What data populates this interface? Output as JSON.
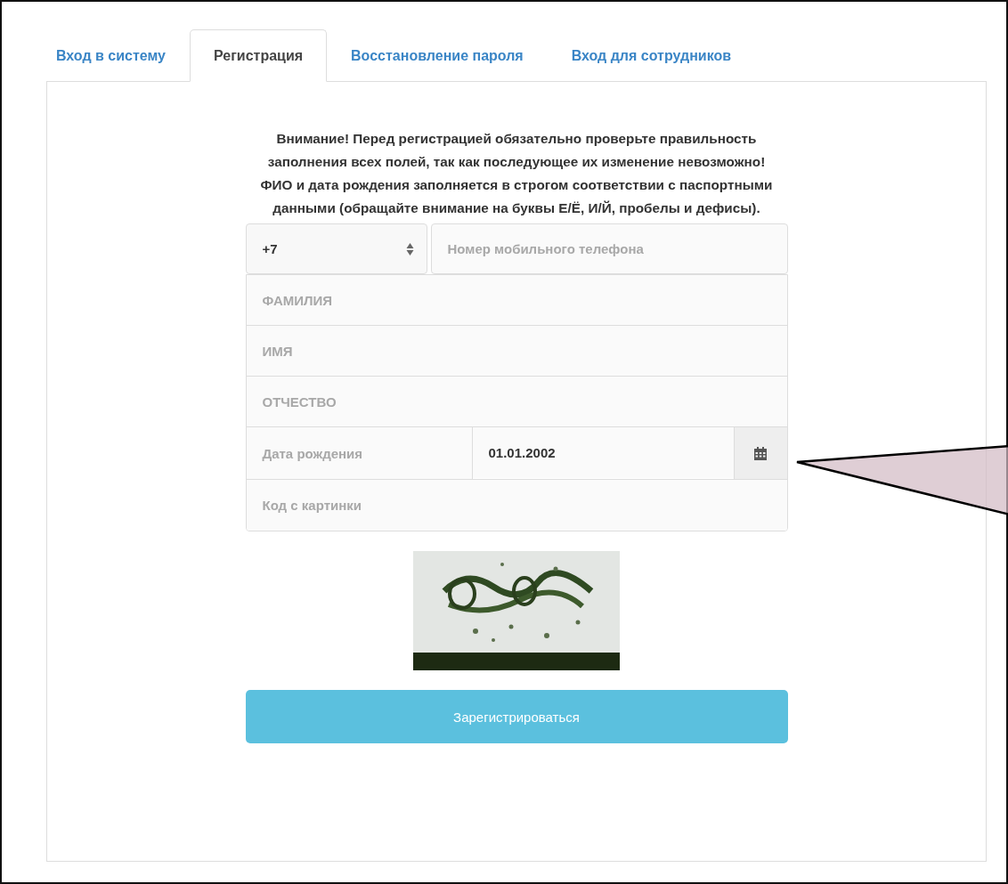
{
  "tabs": [
    {
      "label": "Вход в систему",
      "selected": false
    },
    {
      "label": "Регистрация",
      "selected": true
    },
    {
      "label": "Восстановление пароля",
      "selected": false
    },
    {
      "label": "Вход для сотрудников",
      "selected": false
    }
  ],
  "notice": "Внимание! Перед регистрацией обязательно проверьте правильность заполнения всех полей, так как последующее их изменение невозможно!\nФИО и дата рождения заполняется в строгом соответствии с паспортными данными (обращайте внимание на буквы Е/Ё, И/Й, пробелы и дефисы).",
  "phone": {
    "country_code": "+7",
    "placeholder": "Номер мобильного телефона"
  },
  "name_fields": [
    {
      "placeholder": "ФАМИЛИЯ"
    },
    {
      "placeholder": "ИМЯ"
    },
    {
      "placeholder": "ОТЧЕСТВО"
    }
  ],
  "birth_date": {
    "label": "Дата рождения",
    "value": "01.01.2002"
  },
  "captcha_field": {
    "placeholder": "Код с картинки"
  },
  "submit_button": "Зарегистрироваться"
}
